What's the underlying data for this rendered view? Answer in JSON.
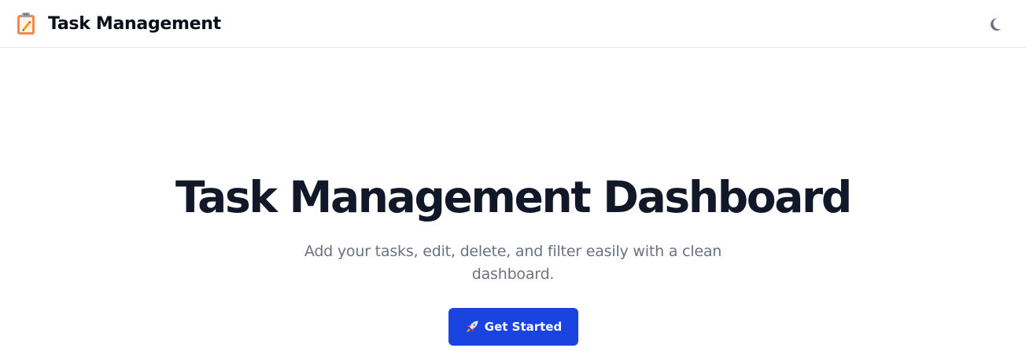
{
  "navbar": {
    "brand_title": "Task Management",
    "brand_icon": "clipboard-icon",
    "theme_toggle_icon": "moon-icon"
  },
  "hero": {
    "title": "Task Management Dashboard",
    "subtitle": "Add your tasks, edit, delete, and filter easily with a clean dashboard.",
    "cta_label": "Get Started",
    "cta_icon": "rocket-icon"
  },
  "colors": {
    "primary_button": "#1a44e0",
    "title_text": "#111827",
    "subtitle_text": "#6b7280",
    "border": "#e5e7eb"
  }
}
